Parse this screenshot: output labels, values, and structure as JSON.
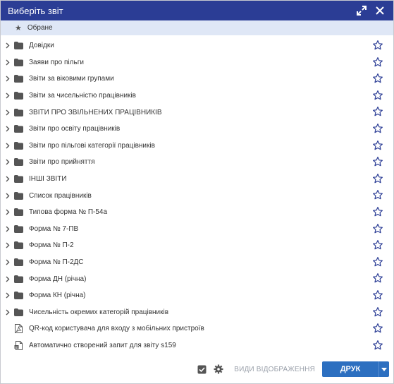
{
  "window": {
    "title": "Виберіть звіт"
  },
  "favorites": {
    "label": "Обране"
  },
  "items": [
    {
      "label": "Довідки",
      "kind": "folder"
    },
    {
      "label": "Заяви про пільги",
      "kind": "folder"
    },
    {
      "label": "Звіти за віковими групами",
      "kind": "folder"
    },
    {
      "label": "Звіти за чисельністю працівників",
      "kind": "folder"
    },
    {
      "label": "ЗВІТИ ПРО ЗВІЛЬНЕНИХ ПРАЦІВНИКІВ",
      "kind": "folder"
    },
    {
      "label": "Звіти про освіту працівників",
      "kind": "folder"
    },
    {
      "label": "Звіти про пільгові категорії працівників",
      "kind": "folder"
    },
    {
      "label": "Звіти про прийняття",
      "kind": "folder"
    },
    {
      "label": "ІНШІ ЗВІТИ",
      "kind": "folder"
    },
    {
      "label": "Список працівників",
      "kind": "folder"
    },
    {
      "label": "Типова форма № П-54а",
      "kind": "folder"
    },
    {
      "label": "Форма № 7-ПВ",
      "kind": "folder"
    },
    {
      "label": "Форма № П-2",
      "kind": "folder"
    },
    {
      "label": "Форма № П-2ДС",
      "kind": "folder"
    },
    {
      "label": "Форма ДН (річна)",
      "kind": "folder"
    },
    {
      "label": "Форма КН (річна)",
      "kind": "folder"
    },
    {
      "label": "Чисельність окремих категорій працівників",
      "kind": "folder"
    },
    {
      "label": "QR-код користувача для входу з мобільних пристроїв",
      "kind": "pdf"
    },
    {
      "label": "Автоматично створений запит для звіту s159",
      "kind": "report"
    }
  ],
  "footer": {
    "view_modes_label": "ВИДИ ВІДОБРАЖЕННЯ",
    "print_label": "ДРУК"
  },
  "colors": {
    "titlebar": "#2b3d95",
    "favorites_row": "#dfe7f6",
    "star_outline": "#2b3d95",
    "print_button": "#2c6fc0"
  }
}
